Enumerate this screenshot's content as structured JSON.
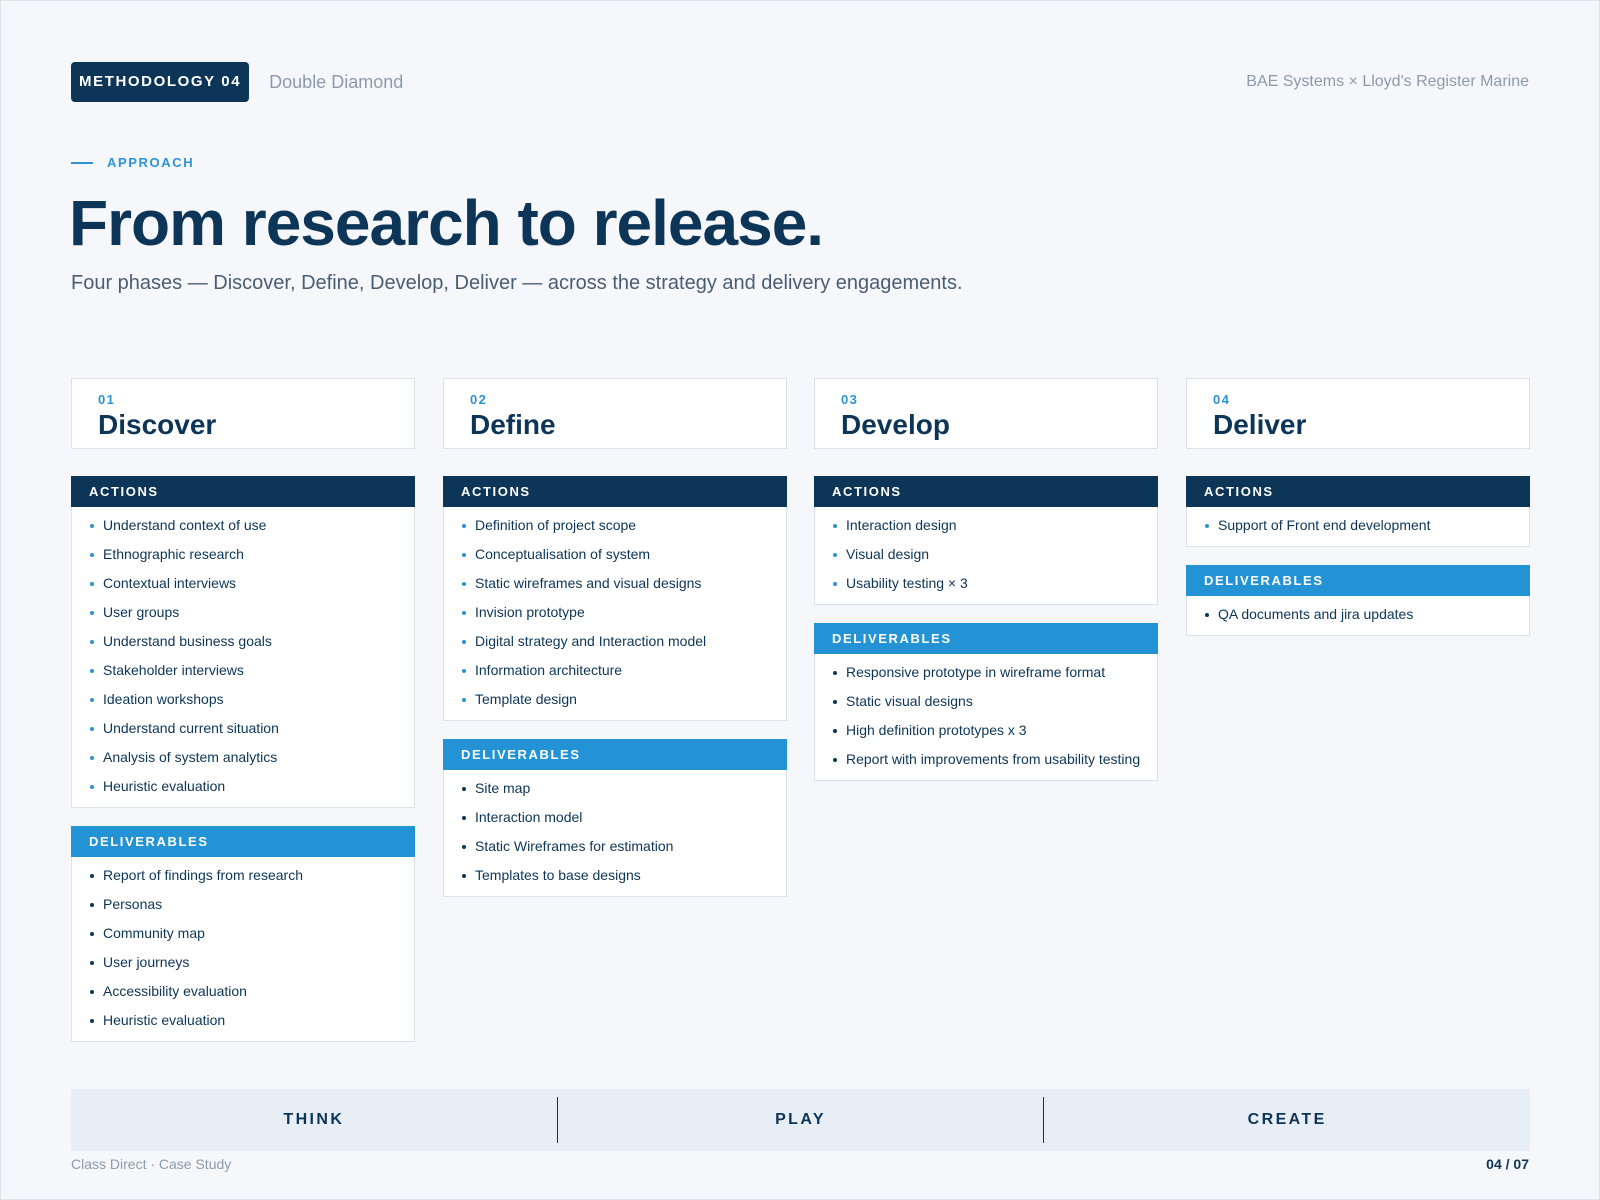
{
  "header": {
    "badge": "METHODOLOGY 04",
    "badge_sub": "Double Diamond",
    "client": "BAE Systems × Lloyd's Register Marine"
  },
  "intro": {
    "eyebrow": "APPROACH",
    "title": "From research to release.",
    "subtitle": "Four phases — Discover, Define, Develop, Deliver — across the strategy and delivery engagements."
  },
  "labels": {
    "actions": "ACTIONS",
    "deliverables": "DELIVERABLES"
  },
  "phases": [
    {
      "num": "01",
      "name": "Discover",
      "actions": [
        "Understand context of use",
        "Ethnographic research",
        "Contextual interviews",
        "User groups",
        "Understand business goals",
        "Stakeholder interviews",
        "Ideation workshops",
        "Understand current situation",
        "Analysis of system analytics",
        "Heuristic evaluation"
      ],
      "deliverables": [
        "Report of findings from research",
        "Personas",
        "Community map",
        "User journeys",
        "Accessibility evaluation",
        "Heuristic evaluation"
      ]
    },
    {
      "num": "02",
      "name": "Define",
      "actions": [
        "Definition of project scope",
        "Conceptualisation of system",
        "Static wireframes and visual designs",
        "Invision prototype",
        "Digital strategy and Interaction model",
        "Information architecture",
        "Template design"
      ],
      "deliverables": [
        "Site map",
        "Interaction model",
        "Static Wireframes for estimation",
        "Templates to base designs"
      ]
    },
    {
      "num": "03",
      "name": "Develop",
      "actions": [
        "Interaction design",
        "Visual design",
        "Usability testing × 3"
      ],
      "deliverables": [
        "Responsive prototype in wireframe format",
        "Static visual designs",
        "High definition prototypes x 3",
        "Report with improvements from usability testing"
      ]
    },
    {
      "num": "04",
      "name": "Deliver",
      "actions": [
        "Support of Front end development"
      ],
      "deliverables": [
        "QA documents and jira updates"
      ]
    }
  ],
  "band": [
    "THINK",
    "PLAY",
    "CREATE"
  ],
  "footer": {
    "left": "Class Direct · Case Study",
    "page": "04 / 07"
  }
}
